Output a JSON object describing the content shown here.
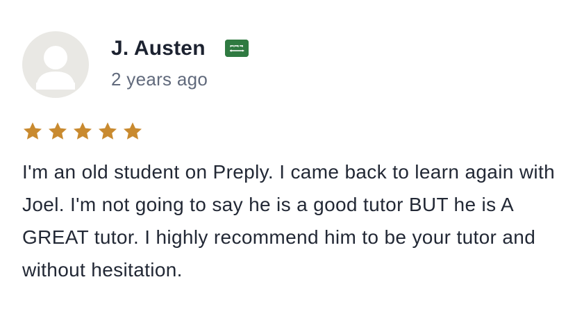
{
  "review": {
    "author": "J. Austen",
    "country_flag": "saudi-arabia-flag-icon",
    "date": "2 years ago",
    "rating": 5,
    "rating_max": 5,
    "text": "I'm an old student on Preply. I came back to learn again with Joel. I'm not going to say he is a good tutor BUT he is A GREAT tutor. I highly recommend him to be your tutor and without hesitation."
  },
  "colors": {
    "star": "#c98a2f",
    "flag": "#2f7a41",
    "avatar_bg": "#e9e8e4",
    "name": "#1c2230",
    "date": "#616a7c"
  }
}
